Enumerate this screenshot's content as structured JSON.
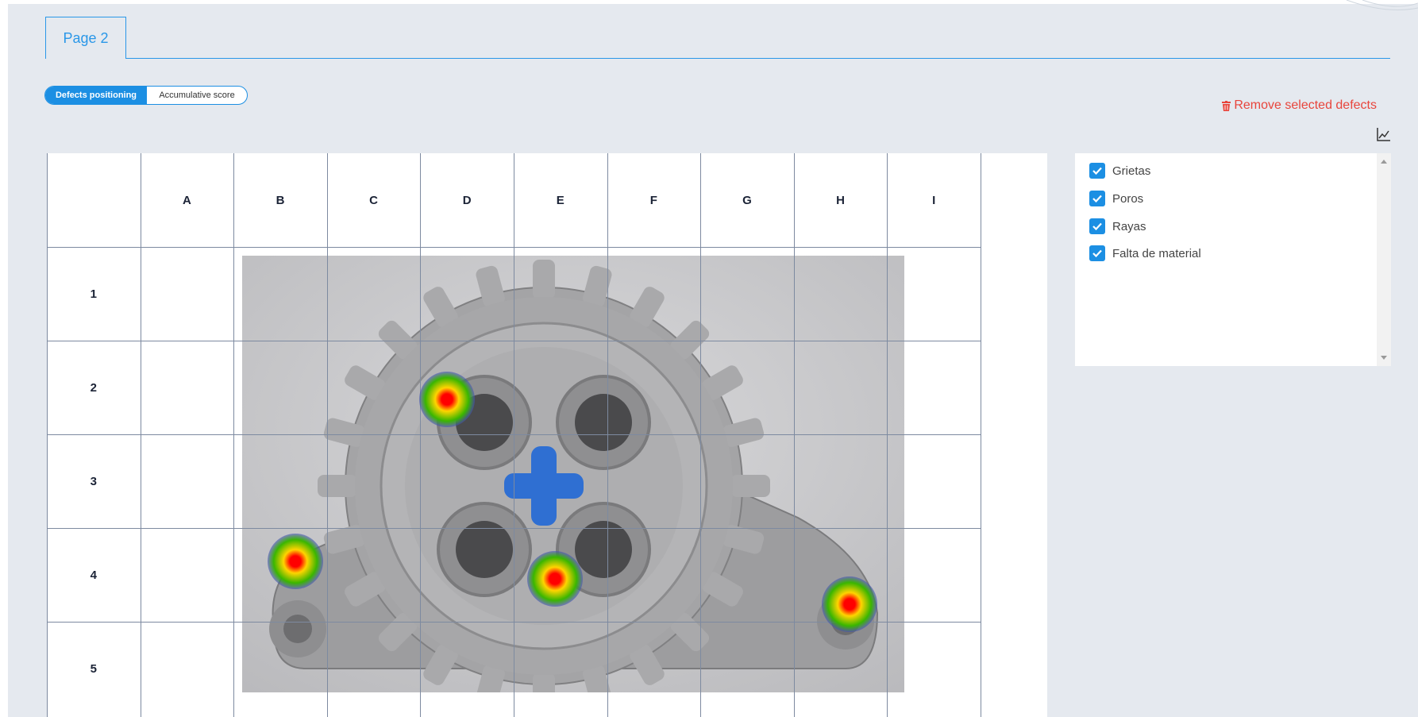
{
  "tabs": [
    {
      "label": "Page 2",
      "active": true
    }
  ],
  "view_toggle": {
    "options": [
      "Defects positioning",
      "Accumulative score"
    ],
    "selected": "Defects positioning"
  },
  "actions": {
    "remove_selected": "Remove selected defects",
    "remove_icon": "trash-icon",
    "chart_icon": "line-chart-icon"
  },
  "grid": {
    "columns": [
      "A",
      "B",
      "C",
      "D",
      "E",
      "F",
      "G",
      "H",
      "I"
    ],
    "rows": [
      "1",
      "2",
      "3",
      "4",
      "5"
    ]
  },
  "defect_markers": [
    {
      "name": "defect-marker-1"
    },
    {
      "name": "defect-marker-2"
    },
    {
      "name": "defect-marker-3"
    },
    {
      "name": "defect-marker-4"
    }
  ],
  "defect_types": [
    {
      "label": "Grietas",
      "checked": true
    },
    {
      "label": "Poros",
      "checked": true
    },
    {
      "label": "Rayas",
      "checked": true
    },
    {
      "label": "Falta de material",
      "checked": true
    }
  ],
  "colors": {
    "accent": "#1c8fe3",
    "danger": "#e8453c",
    "background": "#e5e9ef",
    "grid_line": "#7d8aa0"
  }
}
